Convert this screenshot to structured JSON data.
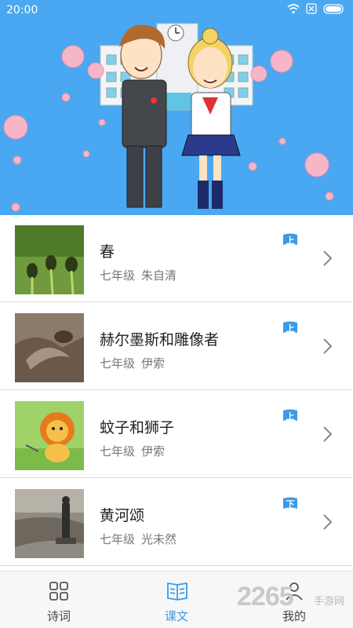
{
  "status_bar": {
    "time": "20:00"
  },
  "lessons": [
    {
      "title": "春",
      "grade": "七年级",
      "author": "朱自清",
      "term": "上"
    },
    {
      "title": "赫尔墨斯和雕像者",
      "grade": "七年级",
      "author": "伊索",
      "term": "上"
    },
    {
      "title": "蚊子和狮子",
      "grade": "七年级",
      "author": "伊索",
      "term": "上"
    },
    {
      "title": "黄河颂",
      "grade": "七年级",
      "author": "光未然",
      "term": "下"
    }
  ],
  "nav": [
    {
      "label": "诗词",
      "icon": "grid-icon",
      "active": false
    },
    {
      "label": "课文",
      "icon": "book-icon",
      "active": true
    },
    {
      "label": "我的",
      "icon": "user-icon",
      "active": false
    }
  ],
  "watermark": {
    "number": "2265",
    "site": "手游网"
  },
  "colors": {
    "header_blue": "#49a8f1",
    "accent_blue": "#3a9ae8",
    "badge_blue": "#3a9ae8"
  }
}
